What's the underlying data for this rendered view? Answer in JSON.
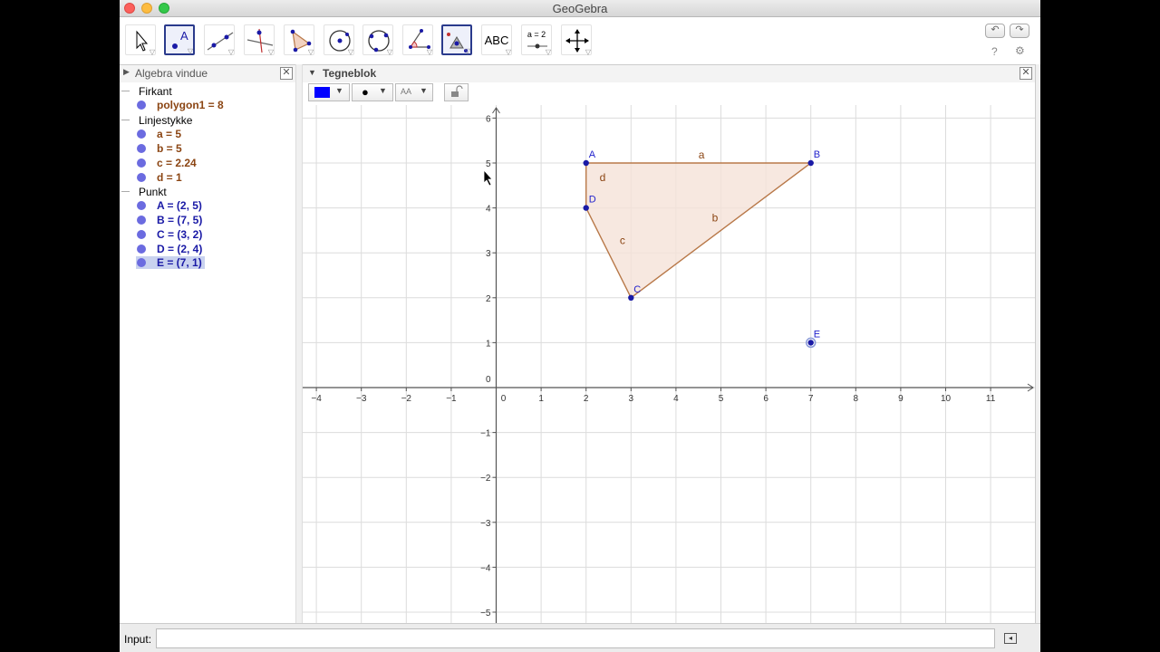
{
  "window": {
    "title": "GeoGebra"
  },
  "toolbar": {
    "tools": [
      {
        "name": "move-tool",
        "icon": "arrow-pointer-icon"
      },
      {
        "name": "point-tool",
        "icon": "point-a-icon",
        "selected": true
      },
      {
        "name": "line-tool",
        "icon": "line-icon"
      },
      {
        "name": "perpendicular-tool",
        "icon": "perpendicular-line-icon"
      },
      {
        "name": "polygon-tool",
        "icon": "polygon-icon"
      },
      {
        "name": "circle-tool",
        "icon": "circle-center-icon"
      },
      {
        "name": "circle-three-points-tool",
        "icon": "circle-three-points-icon"
      },
      {
        "name": "angle-tool",
        "icon": "angle-icon"
      },
      {
        "name": "reflect-tool",
        "icon": "reflect-point-icon",
        "selected": true
      },
      {
        "name": "text-tool",
        "icon": "text-icon",
        "label": "ABC"
      },
      {
        "name": "slider-tool",
        "icon": "slider-icon",
        "label": "a = 2"
      },
      {
        "name": "move-view-tool",
        "icon": "move-graphics-icon"
      }
    ],
    "undo_icon": "undo-icon",
    "redo_icon": "redo-icon",
    "help_label": "?",
    "settings_icon": "gear-icon"
  },
  "algebra": {
    "title": "Algebra vindue",
    "groups": [
      {
        "label": "Firkant",
        "items": [
          {
            "text": "polygon1 = 8",
            "color": "#8b4513"
          }
        ]
      },
      {
        "label": "Linjestykke",
        "items": [
          {
            "text": "a = 5",
            "color": "#8b4513"
          },
          {
            "text": "b = 5",
            "color": "#8b4513"
          },
          {
            "text": "c = 2.24",
            "color": "#8b4513"
          },
          {
            "text": "d = 1",
            "color": "#8b4513"
          }
        ]
      },
      {
        "label": "Punkt",
        "items": [
          {
            "text": "A = (2, 5)",
            "color": "#1a1aa6"
          },
          {
            "text": "B = (7, 5)",
            "color": "#1a1aa6"
          },
          {
            "text": "C = (3, 2)",
            "color": "#1a1aa6"
          },
          {
            "text": "D = (2, 4)",
            "color": "#1a1aa6"
          },
          {
            "text": "E = (7, 1)",
            "color": "#1a1aa6",
            "selected": true
          }
        ]
      }
    ]
  },
  "graphics": {
    "title": "Tegneblok",
    "style": {
      "color": "#0000ff",
      "point_style_icon": "dot-icon",
      "label_style_label": "AA"
    },
    "x_ticks": [
      "-4",
      "-3",
      "-2",
      "-1",
      "0",
      "1",
      "2",
      "3",
      "4",
      "5",
      "6",
      "7",
      "8",
      "9",
      "10",
      "11"
    ],
    "y_ticks": [
      "6",
      "5",
      "4",
      "3",
      "2",
      "1",
      "0",
      "-1",
      "-2",
      "-3",
      "-4",
      "-5"
    ],
    "points": [
      {
        "label": "A",
        "x": 2,
        "y": 5
      },
      {
        "label": "B",
        "x": 7,
        "y": 5
      },
      {
        "label": "C",
        "x": 3,
        "y": 2
      },
      {
        "label": "D",
        "x": 2,
        "y": 4
      },
      {
        "label": "E",
        "x": 7,
        "y": 1
      }
    ],
    "polygon": [
      "A",
      "B",
      "C",
      "D"
    ],
    "segments": [
      {
        "label": "a",
        "from": "A",
        "to": "B"
      },
      {
        "label": "b",
        "from": "B",
        "to": "C"
      },
      {
        "label": "c",
        "from": "C",
        "to": "D"
      },
      {
        "label": "d",
        "from": "D",
        "to": "A"
      }
    ],
    "colors": {
      "polygon_fill": "#f5e2d8",
      "polygon_stroke": "#b87848",
      "segment_label": "#8b4513",
      "point": "#1a1aa6",
      "point_label": "#2222cc",
      "grid": "#dcdcdc",
      "axis": "#555555"
    }
  },
  "input": {
    "label": "Input:",
    "value": ""
  }
}
